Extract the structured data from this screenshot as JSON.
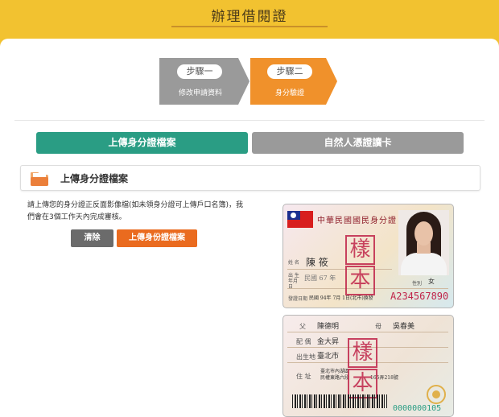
{
  "header": {
    "title": "辦理借閱證"
  },
  "steps": [
    {
      "label": "步驟一",
      "sub": "修改申請資料",
      "state": "done",
      "color": "#9a9a9a"
    },
    {
      "label": "步驟二",
      "sub": "身分驗證",
      "state": "active",
      "color": "#f0912b"
    }
  ],
  "tabs": [
    {
      "label": "上傳身分證檔案",
      "active": true,
      "color": "#2a9d84"
    },
    {
      "label": "自然人憑證讀卡",
      "active": false,
      "color": "#9a9a9a"
    }
  ],
  "section": {
    "icon": "folder-icon",
    "title": "上傳身分證檔案",
    "description": "請上傳您的身分證正反面影像檔(如未領身分證可上傳戶口名簿)，我們會在3個工作天內完成審核。"
  },
  "buttons": {
    "clear": "清除",
    "upload": "上傳身份證檔案"
  },
  "id_front": {
    "title": "中華民國國民身分證",
    "stamp": "樣本",
    "name_label": "姓 名",
    "name_value": "陳  筱",
    "birth_label": "出 生 年月日",
    "birth_value": "民國 67 年",
    "sex_label": "性別",
    "sex_value": "女",
    "issue_label": "發證日期",
    "issue_value": "民國 94年 7月 1日(北市)換發",
    "id_number": "A234567890"
  },
  "id_back": {
    "father_label": "父",
    "father_value": "陳德明",
    "mother_label": "母",
    "mother_value": "吳春美",
    "spouse_label": "配 偶",
    "spouse_value": "金大昇",
    "birthplace_label": "出生地",
    "birthplace_value": "臺北市",
    "address_label": "住 址",
    "address_value_1": "臺北市內湖區",
    "address_value_2": "民權東路六段",
    "address_value_3": "165弄218號",
    "stamp": "樣本",
    "serial": "0000000105"
  }
}
